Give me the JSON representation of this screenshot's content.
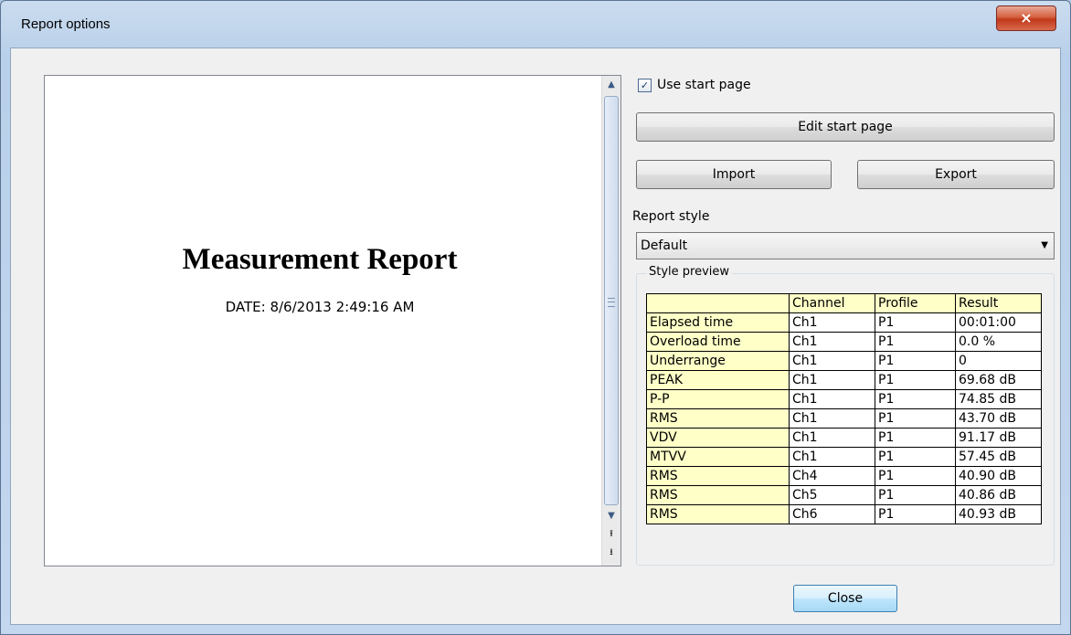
{
  "window": {
    "title": "Report options",
    "close_glyph": "×"
  },
  "preview": {
    "heading": "Measurement Report",
    "date_line": "DATE: 8/6/2013 2:49:16 AM",
    "scroll": {
      "up": "▲",
      "down": "▼",
      "page_up": "⭱",
      "page_down": "⭳"
    }
  },
  "options": {
    "use_start_page": {
      "label": "Use start page",
      "checked": true,
      "check_glyph": "✓"
    },
    "edit_start_page": "Edit start page",
    "import": "Import",
    "export": "Export",
    "report_style_label": "Report style",
    "report_style_value": "Default",
    "dropdown_glyph": "▼",
    "style_preview_label": "Style preview",
    "table": {
      "headers": [
        "",
        "Channel",
        "Profile",
        "Result"
      ],
      "rows": [
        [
          "Elapsed time",
          "Ch1",
          "P1",
          "00:01:00"
        ],
        [
          "Overload time",
          "Ch1",
          "P1",
          "0.0 %"
        ],
        [
          "Underrange",
          "Ch1",
          "P1",
          "0"
        ],
        [
          "PEAK",
          "Ch1",
          "P1",
          "69.68 dB"
        ],
        [
          "P-P",
          "Ch1",
          "P1",
          "74.85 dB"
        ],
        [
          "RMS",
          "Ch1",
          "P1",
          "43.70 dB"
        ],
        [
          "VDV",
          "Ch1",
          "P1",
          "91.17 dB"
        ],
        [
          "MTVV",
          "Ch1",
          "P1",
          "57.45 dB"
        ],
        [
          "RMS",
          "Ch4",
          "P1",
          "40.90 dB"
        ],
        [
          "RMS",
          "Ch5",
          "P1",
          "40.86 dB"
        ],
        [
          "RMS",
          "Ch6",
          "P1",
          "40.93 dB"
        ]
      ]
    }
  },
  "footer": {
    "close": "Close"
  },
  "colors": {
    "header_fill": "#ffffc8",
    "accent": "#3b5b86"
  }
}
